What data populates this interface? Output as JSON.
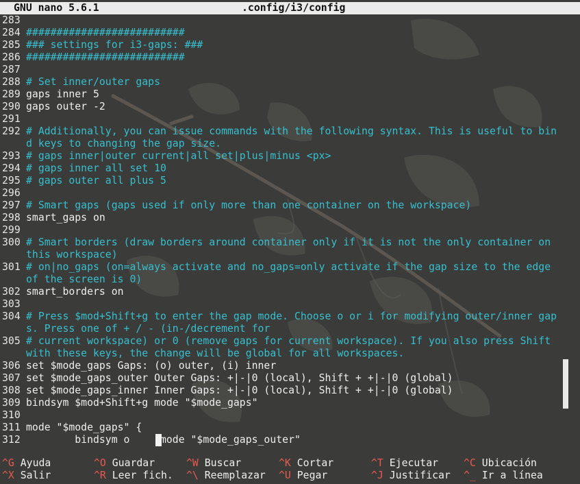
{
  "titlebar": {
    "version": "GNU nano 5.6.1",
    "filename": ".config/i3/config"
  },
  "lines": [
    {
      "n": "283",
      "text": "",
      "comment": false
    },
    {
      "n": "284",
      "text": "##########################",
      "comment": true
    },
    {
      "n": "285",
      "text": "### settings for i3-gaps: ###",
      "comment": true
    },
    {
      "n": "286",
      "text": "##########################",
      "comment": true
    },
    {
      "n": "287",
      "text": "",
      "comment": false
    },
    {
      "n": "288",
      "text": "# Set inner/outer gaps",
      "comment": true
    },
    {
      "n": "289",
      "text": "gaps inner 5",
      "comment": false
    },
    {
      "n": "290",
      "text": "gaps outer -2",
      "comment": false
    },
    {
      "n": "291",
      "text": "",
      "comment": false
    },
    {
      "n": "292",
      "text": "# Additionally, you can issue commands with the following syntax. This is useful to bin",
      "comment": true
    },
    {
      "n": "",
      "text": "d keys to changing the gap size.",
      "comment": true
    },
    {
      "n": "293",
      "text": "# gaps inner|outer current|all set|plus|minus <px>",
      "comment": true
    },
    {
      "n": "294",
      "text": "# gaps inner all set 10",
      "comment": true
    },
    {
      "n": "295",
      "text": "# gaps outer all plus 5",
      "comment": true
    },
    {
      "n": "296",
      "text": "",
      "comment": false
    },
    {
      "n": "297",
      "text": "# Smart gaps (gaps used if only more than one container on the workspace)",
      "comment": true
    },
    {
      "n": "298",
      "text": "smart_gaps on",
      "comment": false
    },
    {
      "n": "299",
      "text": "",
      "comment": false
    },
    {
      "n": "300",
      "text": "# Smart borders (draw borders around container only if it is not the only container on",
      "comment": true
    },
    {
      "n": "",
      "text": "this workspace)",
      "comment": true
    },
    {
      "n": "301",
      "text": "# on|no_gaps (on=always activate and no_gaps=only activate if the gap size to the edge",
      "comment": true
    },
    {
      "n": "",
      "text": "of the screen is 0)",
      "comment": true
    },
    {
      "n": "302",
      "text": "smart_borders on",
      "comment": false
    },
    {
      "n": "303",
      "text": "",
      "comment": false
    },
    {
      "n": "304",
      "text": "# Press $mod+Shift+g to enter the gap mode. Choose o or i for modifying outer/inner gap",
      "comment": true
    },
    {
      "n": "",
      "text": "s. Press one of + / - (in-/decrement for",
      "comment": true
    },
    {
      "n": "305",
      "text": "# current workspace) or 0 (remove gaps for current workspace). If you also press Shift",
      "comment": true
    },
    {
      "n": "",
      "text": "with these keys, the change will be global for all workspaces.",
      "comment": true
    },
    {
      "n": "306",
      "text": "set $mode_gaps Gaps: (o) outer, (i) inner",
      "comment": false
    },
    {
      "n": "307",
      "text": "set $mode_gaps_outer Outer Gaps: +|-|0 (local), Shift + +|-|0 (global)",
      "comment": false
    },
    {
      "n": "308",
      "text": "set $mode_gaps_inner Inner Gaps: +|-|0 (local), Shift + +|-|0 (global)",
      "comment": false
    },
    {
      "n": "309",
      "text": "bindsym $mod+Shift+g mode \"$mode_gaps\"",
      "comment": false
    },
    {
      "n": "310",
      "text": "",
      "comment": false
    },
    {
      "n": "311",
      "text": "mode \"$mode_gaps\" {",
      "comment": false
    },
    {
      "n": "312",
      "text": "        bindsym o     mode \"$mode_gaps_outer\"",
      "comment": false
    }
  ],
  "shortcuts": [
    {
      "key": "^G",
      "label": "Ayuda"
    },
    {
      "key": "^X",
      "label": "Salir"
    },
    {
      "key": "^O",
      "label": "Guardar"
    },
    {
      "key": "^R",
      "label": "Leer fich."
    },
    {
      "key": "^W",
      "label": "Buscar"
    },
    {
      "key": "^\\",
      "label": "Reemplazar"
    },
    {
      "key": "^K",
      "label": "Cortar"
    },
    {
      "key": "^U",
      "label": "Pegar"
    },
    {
      "key": "^T",
      "label": "Ejecutar"
    },
    {
      "key": "^J",
      "label": "Justificar"
    },
    {
      "key": "^C",
      "label": "Ubicación"
    },
    {
      "key": "^_",
      "label": "Ir a línea"
    }
  ],
  "colors": {
    "background": "#3b3b39",
    "comment": "#36c0cf",
    "text": "#efefef",
    "shortcut_key": "#e85a4f",
    "titlebar": "#ebebeb"
  }
}
